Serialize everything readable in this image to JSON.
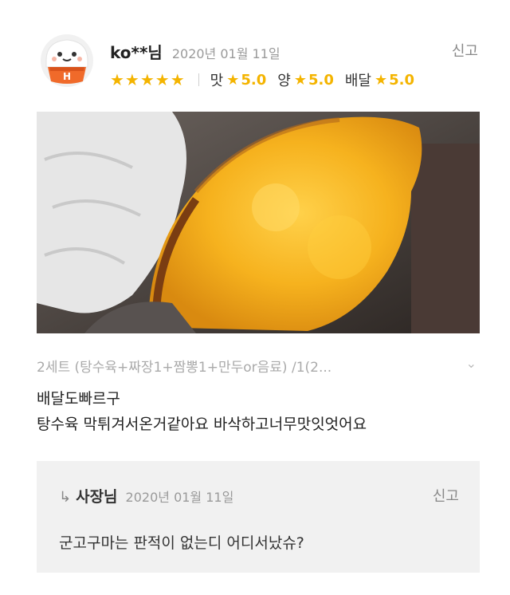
{
  "review": {
    "username": "ko**님",
    "date": "2020년 01월 11일",
    "report_label": "신고",
    "avatar_letter": "H",
    "stars": "★★★★★",
    "ratings": [
      {
        "label": "맛",
        "value": "5.0"
      },
      {
        "label": "양",
        "value": "5.0"
      },
      {
        "label": "배달",
        "value": "5.0"
      }
    ],
    "star_color": "#f4b400",
    "menu": "2세트 (탕수육+짜장1+짬뽕1+만두or음료) /1(2...",
    "text_line1": "배달도빠르구",
    "text_line2": "탕수육 막튀겨서온거같아요 바삭하고너무맛잇엇어요"
  },
  "reply": {
    "name": "사장님",
    "date": "2020년 01월 11일",
    "report_label": "신고",
    "text": "군고구마는 판적이 없는디 어디서났슈?"
  }
}
